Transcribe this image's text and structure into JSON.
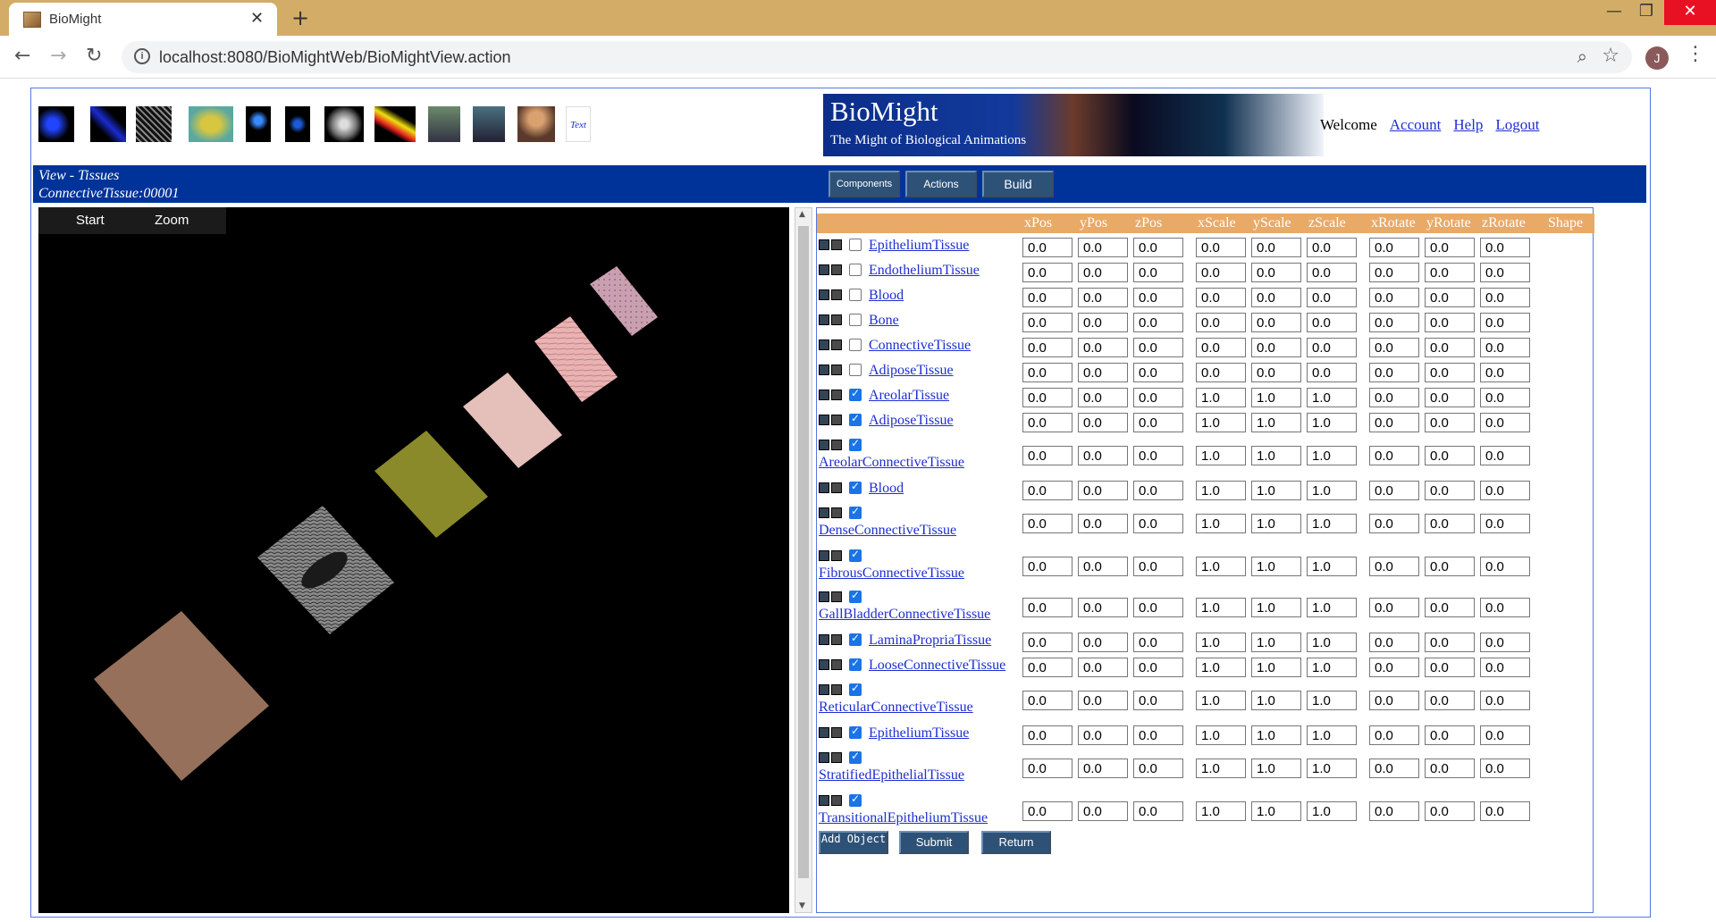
{
  "browser": {
    "tab_title": "BioMight",
    "url": "localhost:8080/BioMightWeb/BioMightView.action",
    "profile_initial": "J"
  },
  "header": {
    "banner_title": "BioMight",
    "banner_subtitle": "The Might of Biological Animations",
    "welcome": "Welcome",
    "account": "Account",
    "help": "Help",
    "logout": "Logout"
  },
  "view": {
    "title": "View - Tissues",
    "object": "ConnectiveTissue:00001",
    "menu_start": "Start",
    "menu_zoom": "Zoom"
  },
  "actions": {
    "components": "Components",
    "actions": "Actions",
    "build": "Build"
  },
  "columns": [
    "xPos",
    "yPos",
    "zPos",
    "xScale",
    "yScale",
    "zScale",
    "xRotate",
    "yRotate",
    "zRotate",
    "Shape"
  ],
  "rows": [
    {
      "name": "EpitheliumTissue",
      "checked": false,
      "values": [
        "0.0",
        "0.0",
        "0.0",
        "0.0",
        "0.0",
        "0.0",
        "0.0",
        "0.0",
        "0.0"
      ]
    },
    {
      "name": "EndotheliumTissue",
      "checked": false,
      "values": [
        "0.0",
        "0.0",
        "0.0",
        "0.0",
        "0.0",
        "0.0",
        "0.0",
        "0.0",
        "0.0"
      ]
    },
    {
      "name": "Blood",
      "checked": false,
      "values": [
        "0.0",
        "0.0",
        "0.0",
        "0.0",
        "0.0",
        "0.0",
        "0.0",
        "0.0",
        "0.0"
      ]
    },
    {
      "name": "Bone",
      "checked": false,
      "values": [
        "0.0",
        "0.0",
        "0.0",
        "0.0",
        "0.0",
        "0.0",
        "0.0",
        "0.0",
        "0.0"
      ]
    },
    {
      "name": "ConnectiveTissue",
      "checked": false,
      "values": [
        "0.0",
        "0.0",
        "0.0",
        "0.0",
        "0.0",
        "0.0",
        "0.0",
        "0.0",
        "0.0"
      ]
    },
    {
      "name": "AdiposeTissue",
      "checked": false,
      "values": [
        "0.0",
        "0.0",
        "0.0",
        "0.0",
        "0.0",
        "0.0",
        "0.0",
        "0.0",
        "0.0"
      ]
    },
    {
      "name": "AreolarTissue",
      "checked": true,
      "values": [
        "0.0",
        "0.0",
        "0.0",
        "1.0",
        "1.0",
        "1.0",
        "0.0",
        "0.0",
        "0.0"
      ]
    },
    {
      "name": "AdiposeTissue",
      "checked": true,
      "values": [
        "0.0",
        "0.0",
        "0.0",
        "1.0",
        "1.0",
        "1.0",
        "0.0",
        "0.0",
        "0.0"
      ]
    },
    {
      "name": "AreolarConnectiveTissue",
      "checked": true,
      "values": [
        "0.0",
        "0.0",
        "0.0",
        "1.0",
        "1.0",
        "1.0",
        "0.0",
        "0.0",
        "0.0"
      ]
    },
    {
      "name": "Blood",
      "checked": true,
      "values": [
        "0.0",
        "0.0",
        "0.0",
        "1.0",
        "1.0",
        "1.0",
        "0.0",
        "0.0",
        "0.0"
      ]
    },
    {
      "name": "DenseConnectiveTissue",
      "checked": true,
      "values": [
        "0.0",
        "0.0",
        "0.0",
        "1.0",
        "1.0",
        "1.0",
        "0.0",
        "0.0",
        "0.0"
      ]
    },
    {
      "name": "FibrousConnectiveTissue",
      "checked": true,
      "values": [
        "0.0",
        "0.0",
        "0.0",
        "1.0",
        "1.0",
        "1.0",
        "0.0",
        "0.0",
        "0.0"
      ]
    },
    {
      "name": "GallBladderConnectiveTissue",
      "checked": true,
      "values": [
        "0.0",
        "0.0",
        "0.0",
        "1.0",
        "1.0",
        "1.0",
        "0.0",
        "0.0",
        "0.0"
      ]
    },
    {
      "name": "LaminaPropriaTissue",
      "checked": true,
      "values": [
        "0.0",
        "0.0",
        "0.0",
        "1.0",
        "1.0",
        "1.0",
        "0.0",
        "0.0",
        "0.0"
      ]
    },
    {
      "name": "LooseConnectiveTissue",
      "checked": true,
      "values": [
        "0.0",
        "0.0",
        "0.0",
        "1.0",
        "1.0",
        "1.0",
        "0.0",
        "0.0",
        "0.0"
      ]
    },
    {
      "name": "ReticularConnectiveTissue",
      "checked": true,
      "values": [
        "0.0",
        "0.0",
        "0.0",
        "1.0",
        "1.0",
        "1.0",
        "0.0",
        "0.0",
        "0.0"
      ]
    },
    {
      "name": "EpitheliumTissue",
      "checked": true,
      "values": [
        "0.0",
        "0.0",
        "0.0",
        "1.0",
        "1.0",
        "1.0",
        "0.0",
        "0.0",
        "0.0"
      ]
    },
    {
      "name": "StratifiedEpithelialTissue",
      "checked": true,
      "values": [
        "0.0",
        "0.0",
        "0.0",
        "1.0",
        "1.0",
        "1.0",
        "0.0",
        "0.0",
        "0.0"
      ]
    },
    {
      "name": "TransitionalEpitheliumTissue",
      "checked": true,
      "values": [
        "0.0",
        "0.0",
        "0.0",
        "1.0",
        "1.0",
        "1.0",
        "0.0",
        "0.0",
        "0.0"
      ]
    }
  ],
  "buttons": {
    "add_object": "Add Object",
    "submit": "Submit",
    "return": "Return"
  }
}
